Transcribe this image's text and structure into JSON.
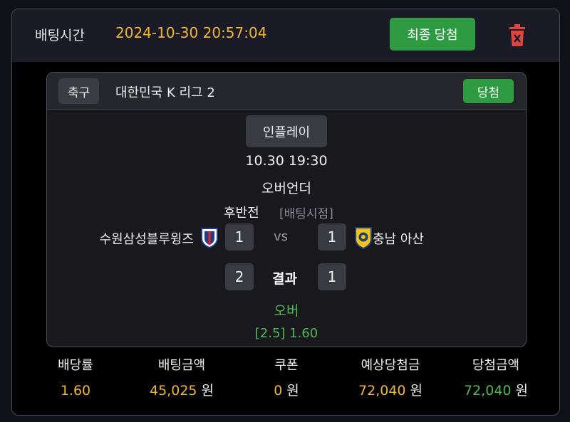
{
  "header": {
    "label": "배팅시간",
    "time": "2024-10-30 20:57:04",
    "final_button": "최종 당첨",
    "delete_icon": "trash-icon"
  },
  "game": {
    "sport": "축구",
    "league": "대한민국 K 리그 2",
    "status_badge": "당첨",
    "inplay": "인플레이",
    "datetime": "10.30 19:30",
    "market": "오버언더",
    "period": "후반전",
    "bet_point": "[배팅시점]",
    "home_team": "수원삼성블루윙즈",
    "away_team": "충남 아산",
    "home_score_at_bet": "1",
    "away_score_at_bet": "1",
    "vs": "vs",
    "result_label": "결과",
    "home_score_final": "2",
    "away_score_final": "1",
    "pick": "오버",
    "pick_odds": "[2.5] 1.60"
  },
  "summary": {
    "odds_label": "배당률",
    "odds": "1.60",
    "amount_label": "배팅금액",
    "amount": "45,025",
    "coupon_label": "쿠폰",
    "coupon": "0",
    "expected_label": "예상당첨금",
    "expected": "72,040",
    "won_label": "당첨금액",
    "won": "72,040",
    "unit": "원"
  },
  "colors": {
    "accent_yellow": "#f0b62e",
    "win_green": "#2e9a41",
    "text_green": "#4fb857",
    "delete_red": "#e0463f"
  }
}
